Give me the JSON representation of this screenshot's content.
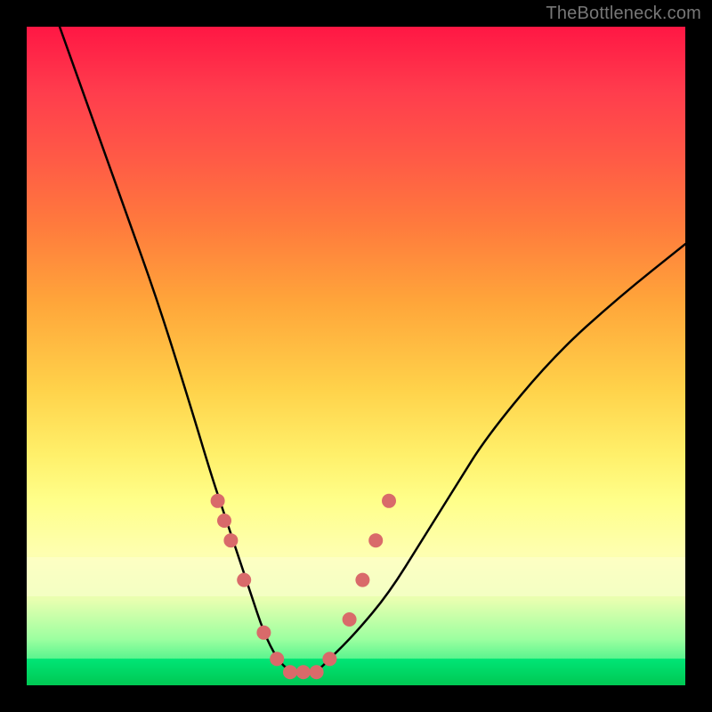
{
  "watermark": "TheBottleneck.com",
  "chart_data": {
    "type": "line",
    "title": "",
    "xlabel": "",
    "ylabel": "",
    "xlim": [
      0,
      100
    ],
    "ylim": [
      0,
      100
    ],
    "grid": false,
    "series": [
      {
        "name": "bottleneck-curve",
        "x": [
          5,
          10,
          15,
          20,
          25,
          28,
          30,
          32,
          34,
          36,
          38,
          40,
          42,
          44,
          46,
          50,
          55,
          60,
          65,
          70,
          80,
          90,
          100
        ],
        "y": [
          100,
          86,
          72,
          58,
          42,
          32,
          26,
          20,
          14,
          8,
          4,
          2,
          2,
          2,
          4,
          8,
          14,
          22,
          30,
          38,
          50,
          59,
          67
        ]
      }
    ],
    "markers": {
      "name": "highlight-dots",
      "color": "#d96a6a",
      "x": [
        29,
        30,
        31,
        33,
        36,
        38,
        40,
        42,
        44,
        46,
        49,
        51,
        53,
        55
      ],
      "y": [
        28,
        25,
        22,
        16,
        8,
        4,
        2,
        2,
        2,
        4,
        10,
        16,
        22,
        28
      ]
    }
  }
}
